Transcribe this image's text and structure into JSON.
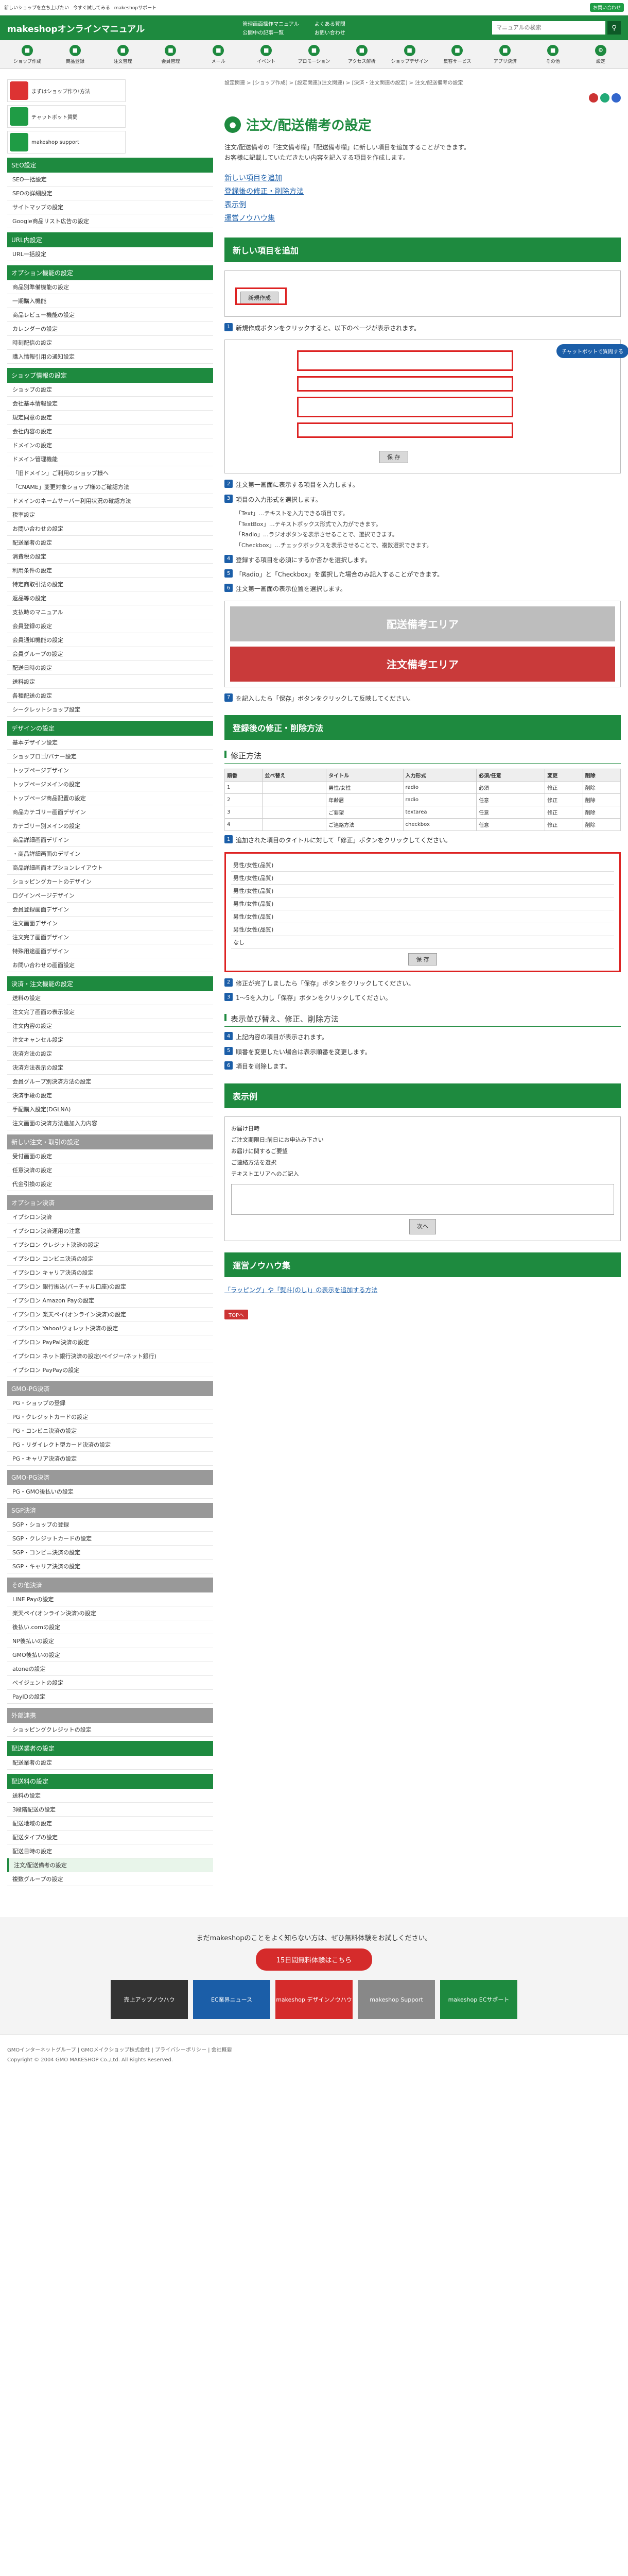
{
  "topbar": {
    "items": [
      "新しいショップを立ち上げたい",
      "今すぐ試してみる",
      "makeshopサポート"
    ],
    "promo": "お問い合わせ"
  },
  "header": {
    "logo": "makeshopオンラインマニュアル",
    "links": [
      "管理画面操作マニュアル",
      "公開中の記事一覧",
      "よくある質問",
      "お問い合わせ"
    ],
    "search_placeholder": "マニュアルの検索"
  },
  "gnav": [
    "ショップ作成",
    "商品登録",
    "注文管理",
    "会員管理",
    "メール",
    "イベント",
    "プロモーション",
    "アクセス解析",
    "ショップデザイン",
    "集客サービス",
    "アプリ決済",
    "その他",
    "設定"
  ],
  "banners": [
    "まずはショップ作り!方法",
    "チャットボット質問",
    "makeshop support"
  ],
  "sidebar": [
    {
      "title": "SEO設定",
      "gray": false,
      "items": [
        "SEO一括設定",
        "SEOの詳細設定",
        "サイトマップの設定",
        "Google商品リスト広告の設定"
      ]
    },
    {
      "title": "URL内設定",
      "gray": false,
      "items": [
        "URL一括設定"
      ]
    },
    {
      "title": "オプション機能の設定",
      "gray": false,
      "items": [
        "商品別準備機能の設定",
        "一期購入機能",
        "商品レビュー機能の設定",
        "カレンダーの設定",
        "時刻配信の設定",
        "購入情報引用の通知設定"
      ]
    },
    {
      "title": "ショップ情報の設定",
      "gray": false,
      "items": [
        "ショップの設定",
        "会社基本情報設定",
        "規定同意の設定",
        "会社内容の設定",
        "ドメインの設定",
        "ドメイン管理機能",
        "「旧ドメイン」ご利用のショップ様へ",
        "「CNAME」変更対象ショップ様のご確認方法",
        "ドメインのネームサーバー利用状況の確認方法",
        "税率設定",
        "お問い合わせの設定",
        "配送業者の設定",
        "消費税の設定",
        "利用条件の設定",
        "特定商取引法の設定",
        "返品等の設定",
        "支払時のマニュアル",
        "会員登録の設定",
        "会員通知機能の設定",
        "会員グループの設定",
        "配送日時の設定",
        "送料設定",
        "各種配送の設定",
        "シークレットショップ設定"
      ]
    },
    {
      "title": "デザインの設定",
      "gray": false,
      "items": [
        "基本デザイン設定",
        "ショップロゴ/バナー設定",
        "トップページデザイン",
        "トップページメインの設定",
        "トップページ商品配置の設定",
        "商品カテゴリー画面デザイン",
        "カテゴリー別メインの設定",
        "商品詳細画面デザイン",
        "・商品詳細画面のデザイン",
        "商品詳細画面オプションレイアウト",
        "ショッピングカートのデザイン",
        "ログインページデザイン",
        "会員登録画面デザイン",
        "注文画面デザイン",
        "注文完了画面デザイン",
        "特殊用途画面デザイン",
        "お問い合わせの画面設定"
      ]
    },
    {
      "title": "決済・注文機能の設定",
      "gray": false,
      "items": [
        "送料の設定",
        "注文完了画面の表示設定",
        "注文内容の設定",
        "注文キャンセル設定",
        "決済方法の設定",
        "決済方法表示の設定",
        "会員グループ別決済方法の設定",
        "決済手段の設定",
        "手配購入設定(DGLNA)",
        "注文画面の決済方法追加入力内容"
      ]
    },
    {
      "title": "新しい注文・取引の設定",
      "gray": true,
      "items": [
        "受付画面の設定",
        "任意決済の設定",
        "代金引換の設定"
      ]
    },
    {
      "title": "オプション決済",
      "gray": true,
      "items": [
        "イプシロン決済",
        "イプシロン決済運用の注意",
        "イプシロン クレジット決済の設定",
        "イプシロン コンビニ決済の設定",
        "イプシロン キャリア決済の設定",
        "イプシロン 銀行振込(バーチャル口座)の設定",
        "イプシロン Amazon Payの設定",
        "イプシロン 楽天ペイ(オンライン決済)の設定",
        "イプシロン Yahoo!ウォレット決済の設定",
        "イプシロン PayPal決済の設定",
        "イプシロン ネット銀行決済の設定(ペイジー/ネット銀行)",
        "イプシロン PayPayの設定"
      ]
    },
    {
      "title": "GMO-PG決済",
      "gray": true,
      "items": [
        "PG・ショップの登録",
        "PG・クレジットカードの設定",
        "PG・コンビニ決済の設定",
        "PG・リダイレクト型カード決済の設定",
        "PG・キャリア決済の設定"
      ]
    },
    {
      "title": "GMO-PG決済",
      "gray": true,
      "items": [
        "PG・GMO後払いの設定"
      ]
    },
    {
      "title": "SGP決済",
      "gray": true,
      "items": [
        "SGP・ショップの登録",
        "SGP・クレジットカードの設定",
        "SGP・コンビニ決済の設定",
        "SGP・キャリア決済の設定"
      ]
    },
    {
      "title": "その他決済",
      "gray": true,
      "items": [
        "LINE Payの設定",
        "楽天ペイ(オンライン決済)の設定",
        "後払い.comの設定",
        "NP後払いの設定",
        "GMO後払いの設定",
        "atoneの設定",
        "ペイジェントの設定",
        "PayIDの設定"
      ]
    },
    {
      "title": "外部連携",
      "gray": true,
      "items": [
        "ショッピングクレジットの設定"
      ]
    },
    {
      "title": "配送業者の設定",
      "gray": false,
      "items": [
        "配送業者の設定"
      ]
    },
    {
      "title": "配送料の設定",
      "gray": false,
      "items": [
        "送料の設定",
        "3段階配送の設定",
        "配送地域の設定",
        "配送タイプの設定",
        "配送日時の設定",
        "注文/配送備考の設定",
        "複数グループの設定"
      ]
    }
  ],
  "active_item": "注文/配送備考の設定",
  "breadcrumb": "設定関連 > [ショップ作成] > [設定関連](注文関連) > [決済・注文関連の設定] > 注文/配送備考の設定",
  "page_title": "注文/配送備考の設定",
  "intro": "注文/配送備考の「注文備考欄」「配送備考欄」に新しい項目を追加することができます。\nお客様に記載していただきたい内容を記入する項目を作成します。",
  "toc": [
    "新しい項目を追加",
    "登録後の修正・削除方法",
    "表示例",
    "運営ノウハウ集"
  ],
  "sec1": {
    "title": "新しい項目を追加",
    "new_button": "新規作成",
    "steps": [
      "新規作成ボタンをクリックすると、以下のページが表示されます。",
      "注文第一画面に表示する項目を入力します。",
      "項目の入力形式を選択します。",
      "登録する項目を必須にするか否かを選択します。",
      "「Radio」と「Checkbox」を選択した場合のみ記入することができます。",
      "注文第一画面の表示位置を選択します。",
      "を記入したら「保存」ボタンをクリックして反映してください。"
    ],
    "notes": [
      "「Text」…テキストを入力できる項目です。",
      "「TextBox」…テキストボックス形式で入力ができます。",
      "「Radio」…ラジオボタンを表示させることで、選択できます。",
      "「Checkbox」…チェックボックスを表示させることで、複数選択できます。"
    ],
    "area1": "配送備考エリア",
    "area2": "注文備考エリア",
    "save": "保 存",
    "chatbot": "チャットボットで質問する"
  },
  "sec2": {
    "title": "登録後の修正・削除方法",
    "sub1": "修正方法",
    "sub2": "表示並び替え、修正、削除方法",
    "table_headers": [
      "順番",
      "並べ替え",
      "タイトル",
      "入力形式",
      "必須/任意",
      "変更",
      "削除"
    ],
    "rows": [
      [
        "1",
        "",
        "男性/女性",
        "radio",
        "必須",
        "修正",
        "削除"
      ],
      [
        "2",
        "",
        "年齢層",
        "radio",
        "任意",
        "修正",
        "削除"
      ],
      [
        "3",
        "",
        "ご要望",
        "textarea",
        "任意",
        "修正",
        "削除"
      ],
      [
        "4",
        "",
        "ご連絡方法",
        "checkbox",
        "任意",
        "修正",
        "削除"
      ]
    ],
    "list_items": [
      "男性/女性(品質)",
      "男性/女性(品質)",
      "男性/女性(品質)",
      "男性/女性(品質)",
      "男性/女性(品質)",
      "男性/女性(品質)",
      "なし"
    ],
    "steps": [
      "追加された項目のタイトルに対して「修正」ボタンをクリックしてください。",
      "修正が完了しましたら「保存」ボタンをクリックしてください。",
      "1〜5を入力し「保存」ボタンをクリックしてください。",
      "上記内容の項目が表示されます。",
      "順番を変更したい場合は表示順番を変更します。",
      "項目を削除します。"
    ]
  },
  "sec3": {
    "title": "表示例",
    "lines": [
      "お届け日時",
      "ご注文期限日:前日にお申込み下さい",
      "お届けに関するご要望",
      "ご連絡方法を選択",
      "テキストエリアへのご記入"
    ],
    "submit": "次へ"
  },
  "sec4": {
    "title": "運営ノウハウ集",
    "link": "「ラッピング」や「熨斗(のし)」の表示を追加する方法",
    "top": "TOPへ"
  },
  "footer": {
    "question": "まだmakeshopのことをよく知らない方は、ぜひ無料体験をお試しください。",
    "cta": "15日間無料体験はこちら",
    "banners": [
      "売上アップノウハウ",
      "EC業界ニュース",
      "makeshop デザインノウハウ",
      "makeshop Support",
      "makeshop ECサポート"
    ],
    "links": "GMOインターネットグループ | GMOメイクショップ株式会社 | プライバシーポリシー | 会社概要",
    "copyright": "Copyright © 2004 GMO MAKESHOP Co.,Ltd. All Rights Reserved."
  }
}
